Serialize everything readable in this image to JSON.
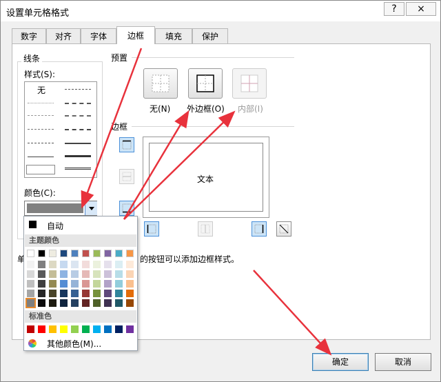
{
  "window": {
    "title": "设置单元格格式",
    "help_glyph": "?",
    "close_glyph": "×"
  },
  "tabs": [
    "数字",
    "对齐",
    "字体",
    "边框",
    "填充",
    "保护"
  ],
  "active_tab": "边框",
  "line": {
    "group_label": "线条",
    "style_label": "样式(S):",
    "style_key": "S",
    "style_none": "无",
    "color_label": "颜色(C):",
    "color_key": "C",
    "color_value": "#808080"
  },
  "presets": {
    "group_label": "预置",
    "none_label": "无(N)",
    "outline_label": "外边框(O)",
    "inside_label": "内部(I)"
  },
  "border": {
    "group_label": "边框",
    "preview_text": "文本"
  },
  "hint_text_visible": "的按钮可以添加边框样式。",
  "hint_prefix_visible": "单",
  "color_menu": {
    "auto_label": "自动",
    "theme_header": "主题颜色",
    "standard_header": "标准色",
    "more_colors_label": "其他颜色(M)...",
    "theme_top": [
      "#ffffff",
      "#000000",
      "#eeece1",
      "#1f497d",
      "#4f81bd",
      "#c0504d",
      "#9bbb59",
      "#8064a2",
      "#4bacc6",
      "#f79646"
    ],
    "theme_shades": [
      [
        "#f2f2f2",
        "#7f7f7f",
        "#ddd9c3",
        "#c6d9f0",
        "#dbe5f1",
        "#f2dcdb",
        "#ebf1dd",
        "#e5e0ec",
        "#dbeef3",
        "#fdeada"
      ],
      [
        "#d8d8d8",
        "#595959",
        "#c4bd97",
        "#8db3e2",
        "#b8cce4",
        "#e5b9b7",
        "#d7e3bc",
        "#ccc1d9",
        "#b7dde8",
        "#fbd5b5"
      ],
      [
        "#bfbfbf",
        "#3f3f3f",
        "#938953",
        "#548dd4",
        "#95b3d7",
        "#d99694",
        "#c3d69b",
        "#b2a2c7",
        "#92cddc",
        "#fac08f"
      ],
      [
        "#a5a5a5",
        "#262626",
        "#494429",
        "#17365d",
        "#366092",
        "#953734",
        "#76923c",
        "#5f497a",
        "#31859b",
        "#e36c09"
      ],
      [
        "#7f7f7f",
        "#0c0c0c",
        "#1d1b10",
        "#0f243e",
        "#244061",
        "#632423",
        "#4f6128",
        "#3f3151",
        "#205867",
        "#974806"
      ]
    ],
    "standard": [
      "#c00000",
      "#ff0000",
      "#ffc000",
      "#ffff00",
      "#92d050",
      "#00b050",
      "#00b0f0",
      "#0070c0",
      "#002060",
      "#7030a0"
    ]
  },
  "buttons": {
    "ok": "确定",
    "cancel": "取消"
  },
  "colors": {
    "annotation_arrow": "#e8323c",
    "selection_blue": "#4a90d9"
  }
}
